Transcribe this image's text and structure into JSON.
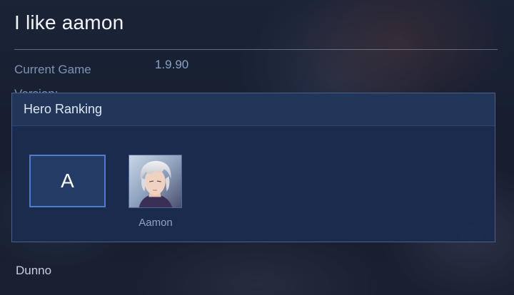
{
  "page": {
    "title": "I like aamon",
    "info": {
      "label": "Current Game Version:",
      "value": "1.9.90"
    },
    "footer_text": "Dunno"
  },
  "ranking_panel": {
    "header": "Hero Ranking",
    "tier": "A",
    "heroes": [
      {
        "name": "Aamon",
        "portrait_icon": "hero-aamon-portrait"
      }
    ]
  },
  "colors": {
    "panel_bg": "#1b2c4f",
    "panel_header_bg": "#213659",
    "tier_border": "#4f7bd0",
    "muted_text": "#7f93b4"
  }
}
